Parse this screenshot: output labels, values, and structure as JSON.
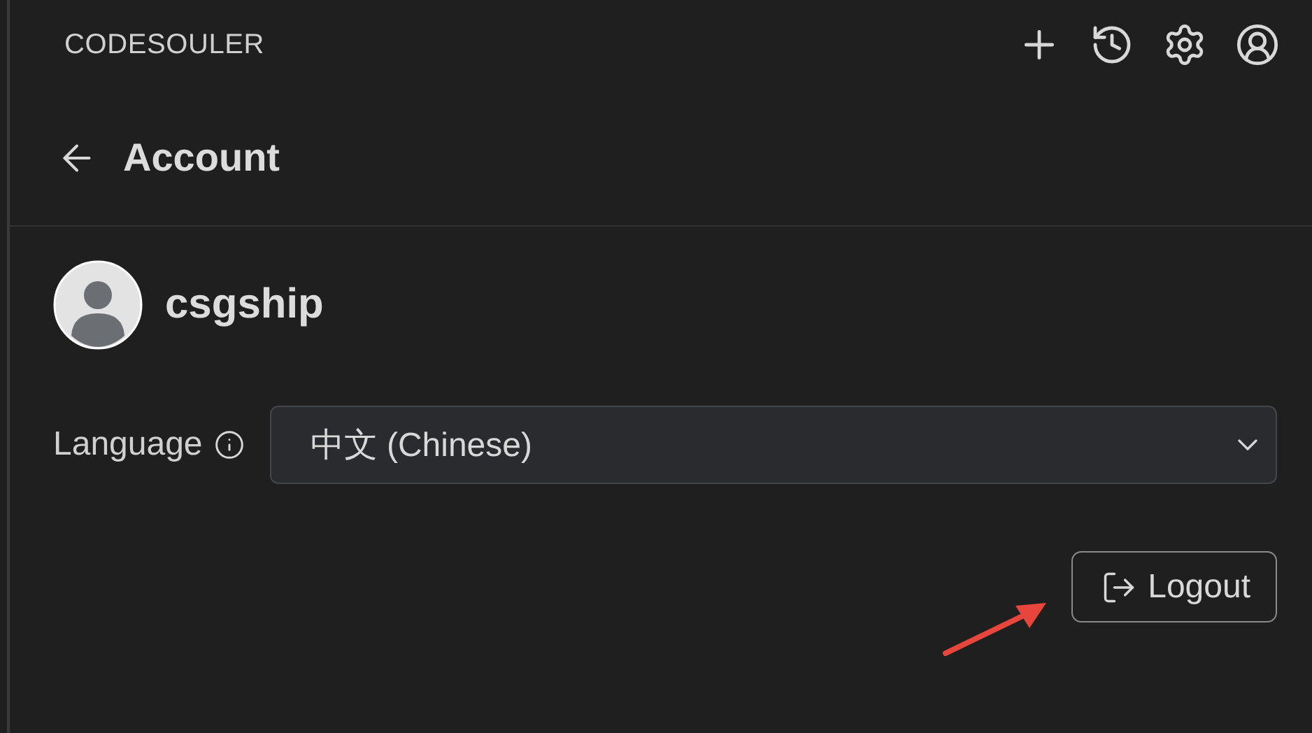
{
  "header": {
    "title": "CODESOULER"
  },
  "page": {
    "title": "Account"
  },
  "user": {
    "name": "csgship"
  },
  "language": {
    "label": "Language",
    "value": "中文 (Chinese)"
  },
  "logout_button": {
    "label": "Logout"
  }
}
